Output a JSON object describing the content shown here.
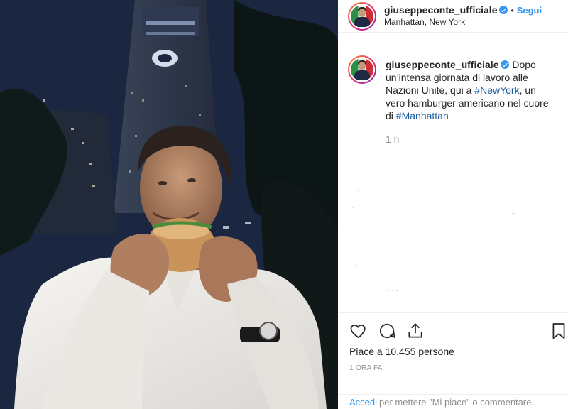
{
  "post": {
    "username": "giuseppeconte_ufficiale",
    "follow_label": "Segui",
    "location": "Manhattan, New York",
    "caption": {
      "part1": "Dopo un’intensa giornata di lavoro alle Nazioni Unite, qui a ",
      "hashtag1": "#NewYork",
      "part2": ", un vero hamburger americano nel cuore di ",
      "hashtag2": "#Manhattan"
    },
    "caption_age": "1 h",
    "likes_text": "Piace a 10.455 persone",
    "date_text": "1 ORA FA",
    "login_link": "Accedi",
    "login_rest": "per mettere \"Mi piace\" o commentare."
  },
  "colors": {
    "link_blue": "#3897f0",
    "hashtag_blue": "#003569",
    "verified_badge": "#3897f0",
    "muted_text": "#8e8e8e",
    "separator": "#efefef"
  },
  "icons": {
    "header_verified": "verified-badge-icon",
    "like": "heart-outline-icon",
    "comment": "comment-bubble-icon",
    "share": "share-upload-icon",
    "save": "bookmark-outline-icon"
  }
}
